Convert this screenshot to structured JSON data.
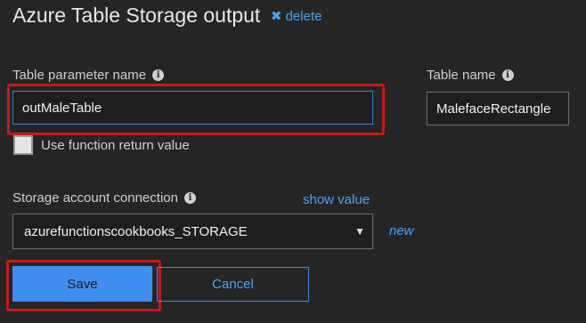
{
  "header": {
    "title": "Azure Table Storage output",
    "delete_label": "delete",
    "delete_icon": "x-icon"
  },
  "table_parameter": {
    "label": "Table parameter name",
    "value": "outMaleTable",
    "info_glyph": "i"
  },
  "table_name": {
    "label": "Table name",
    "value": "MalefaceRectangle",
    "info_glyph": "i"
  },
  "use_return": {
    "label": "Use function return value",
    "checked": false
  },
  "storage": {
    "label": "Storage account connection",
    "show_value": "show value",
    "selected": "azurefunctionscookbooks_STORAGE",
    "new_label": "new",
    "info_glyph": "i"
  },
  "actions": {
    "save_label": "Save",
    "cancel_label": "Cancel"
  },
  "colors": {
    "background": "#252526",
    "accent": "#3d8eef",
    "link": "#4aa3f0",
    "highlight": "#c4191b"
  }
}
